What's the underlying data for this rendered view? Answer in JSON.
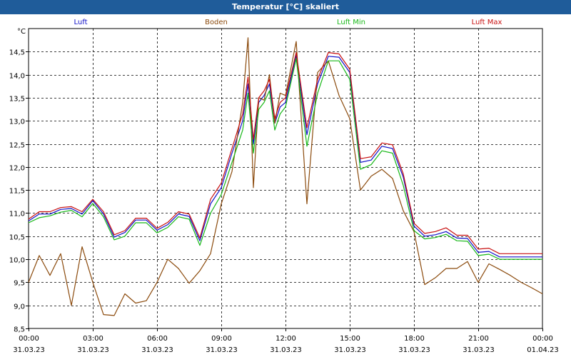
{
  "window_title": "Temperatur [°C] skaliert",
  "colors": {
    "titlebar": "#1f5c9a",
    "background": "#ffffff",
    "grid": "#000000"
  },
  "chart_data": {
    "type": "line",
    "title": "Temperatur [°C] skaliert",
    "ylabel": "°C",
    "xlabel": "",
    "ylim": [
      8.5,
      15.0
    ],
    "y_ticks": [
      8.5,
      9.0,
      9.5,
      10.0,
      10.5,
      11.0,
      11.5,
      12.0,
      12.5,
      13.0,
      13.5,
      14.0,
      14.5
    ],
    "y_tick_labels": [
      "8,5",
      "9,0",
      "9,5",
      "10,0",
      "10,5",
      "11,0",
      "11,5",
      "12,0",
      "12,5",
      "13,0",
      "13,5",
      "14,0",
      "14,5"
    ],
    "x_range_hours": [
      0,
      24
    ],
    "x_ticks": [
      {
        "time": "00:00",
        "date": "31.03.23"
      },
      {
        "time": "03:00",
        "date": "31.03.23"
      },
      {
        "time": "06:00",
        "date": "31.03.23"
      },
      {
        "time": "09:00",
        "date": "31.03.23"
      },
      {
        "time": "12:00",
        "date": "31.03.23"
      },
      {
        "time": "15:00",
        "date": "31.03.23"
      },
      {
        "time": "18:00",
        "date": "31.03.23"
      },
      {
        "time": "21:00",
        "date": "31.03.23"
      },
      {
        "time": "00:00",
        "date": "01.04.23"
      }
    ],
    "grid": true,
    "legend_placement": "top",
    "series": [
      {
        "name": "Luft",
        "color": "#1010c8",
        "x": [
          0,
          0.5,
          1,
          1.5,
          2,
          2.5,
          3,
          3.5,
          4,
          4.5,
          5,
          5.5,
          6,
          6.5,
          7,
          7.5,
          8,
          8.5,
          9,
          9.5,
          10,
          10.25,
          10.5,
          10.75,
          11,
          11.25,
          11.5,
          11.75,
          12,
          12.5,
          13,
          13.5,
          14,
          14.5,
          15,
          15.5,
          16,
          16.5,
          17,
          17.5,
          18,
          18.5,
          19,
          19.5,
          20,
          20.5,
          21,
          21.5,
          22,
          22.5,
          23,
          23.5,
          24
        ],
        "y": [
          10.83,
          10.98,
          10.98,
          11.08,
          11.1,
          10.98,
          11.27,
          10.98,
          10.48,
          10.58,
          10.85,
          10.85,
          10.63,
          10.75,
          10.98,
          10.93,
          10.4,
          11.2,
          11.55,
          12.3,
          13.0,
          13.8,
          12.5,
          13.4,
          13.55,
          13.8,
          12.95,
          13.3,
          13.4,
          14.42,
          12.7,
          13.8,
          14.4,
          14.38,
          14.05,
          12.1,
          12.15,
          12.45,
          12.4,
          11.78,
          10.72,
          10.5,
          10.53,
          10.6,
          10.46,
          10.45,
          10.15,
          10.17,
          10.05,
          10.05,
          10.05,
          10.05,
          10.05
        ]
      },
      {
        "name": "Boden",
        "color": "#8b4a0c",
        "x": [
          0,
          0.5,
          1,
          1.5,
          2,
          2.5,
          3,
          3.5,
          4,
          4.5,
          5,
          5.5,
          6,
          6.5,
          7,
          7.5,
          8,
          8.5,
          9,
          9.5,
          10,
          10.25,
          10.5,
          10.75,
          11,
          11.25,
          11.5,
          11.75,
          12,
          12.5,
          13,
          13.5,
          14,
          14.5,
          15,
          15.5,
          16,
          16.5,
          17,
          17.5,
          18,
          18.5,
          19,
          19.5,
          20,
          20.5,
          21,
          21.5,
          22,
          22.5,
          23,
          23.5,
          24
        ],
        "y": [
          9.5,
          10.08,
          9.65,
          10.12,
          9.0,
          10.27,
          9.5,
          8.8,
          8.78,
          9.25,
          9.05,
          9.1,
          9.5,
          10.0,
          9.8,
          9.48,
          9.75,
          10.12,
          11.2,
          11.9,
          13.4,
          14.8,
          11.55,
          13.5,
          13.45,
          14.0,
          12.95,
          13.6,
          13.55,
          14.72,
          11.2,
          14.05,
          14.3,
          13.55,
          13.05,
          11.5,
          11.8,
          11.95,
          11.75,
          11.05,
          10.6,
          9.45,
          9.6,
          9.8,
          9.8,
          9.95,
          9.5,
          9.9,
          9.78,
          9.65,
          9.5,
          9.38,
          9.25
        ]
      },
      {
        "name": "Luft Min",
        "color": "#18b818",
        "x": [
          0,
          0.5,
          1,
          1.5,
          2,
          2.5,
          3,
          3.5,
          4,
          4.5,
          5,
          5.5,
          6,
          6.5,
          7,
          7.5,
          8,
          8.5,
          9,
          9.5,
          10,
          10.25,
          10.5,
          10.75,
          11,
          11.25,
          11.5,
          11.75,
          12,
          12.5,
          13,
          13.5,
          14,
          14.5,
          15,
          15.5,
          16,
          16.5,
          17,
          17.5,
          18,
          18.5,
          19,
          19.5,
          20,
          20.5,
          21,
          21.5,
          22,
          22.5,
          23,
          23.5,
          24
        ],
        "y": [
          10.79,
          10.9,
          10.94,
          11.02,
          11.06,
          10.92,
          11.21,
          10.92,
          10.42,
          10.5,
          10.79,
          10.79,
          10.57,
          10.69,
          10.92,
          10.87,
          10.3,
          11.0,
          11.4,
          12.1,
          12.8,
          13.6,
          12.3,
          13.25,
          13.4,
          13.65,
          12.8,
          13.15,
          13.3,
          14.35,
          12.45,
          13.6,
          14.3,
          14.3,
          13.9,
          11.95,
          12.05,
          12.35,
          12.3,
          11.6,
          10.62,
          10.44,
          10.47,
          10.54,
          10.4,
          10.39,
          10.08,
          10.11,
          10.0,
          10.0,
          10.0,
          10.0,
          10.0
        ]
      },
      {
        "name": "Luft Max",
        "color": "#c81010",
        "x": [
          0,
          0.5,
          1,
          1.5,
          2,
          2.5,
          3,
          3.5,
          4,
          4.5,
          5,
          5.5,
          6,
          6.5,
          7,
          7.5,
          8,
          8.5,
          9,
          9.5,
          10,
          10.25,
          10.5,
          10.75,
          11,
          11.25,
          11.5,
          11.75,
          12,
          12.5,
          13,
          13.5,
          14,
          14.5,
          15,
          15.5,
          16,
          16.5,
          17,
          17.5,
          18,
          18.5,
          19,
          19.5,
          20,
          20.5,
          21,
          21.5,
          22,
          22.5,
          23,
          23.5,
          24
        ],
        "y": [
          10.87,
          11.03,
          11.03,
          11.12,
          11.14,
          11.03,
          11.3,
          11.03,
          10.53,
          10.62,
          10.89,
          10.89,
          10.67,
          10.8,
          11.03,
          10.98,
          10.46,
          11.3,
          11.65,
          12.4,
          13.15,
          13.95,
          12.6,
          13.5,
          13.65,
          13.9,
          13.05,
          13.4,
          13.5,
          14.48,
          12.85,
          13.9,
          14.48,
          14.45,
          14.12,
          12.18,
          12.22,
          12.52,
          12.48,
          11.85,
          10.78,
          10.56,
          10.6,
          10.68,
          10.52,
          10.52,
          10.22,
          10.24,
          10.12,
          10.12,
          10.12,
          10.12,
          10.12
        ]
      }
    ]
  }
}
